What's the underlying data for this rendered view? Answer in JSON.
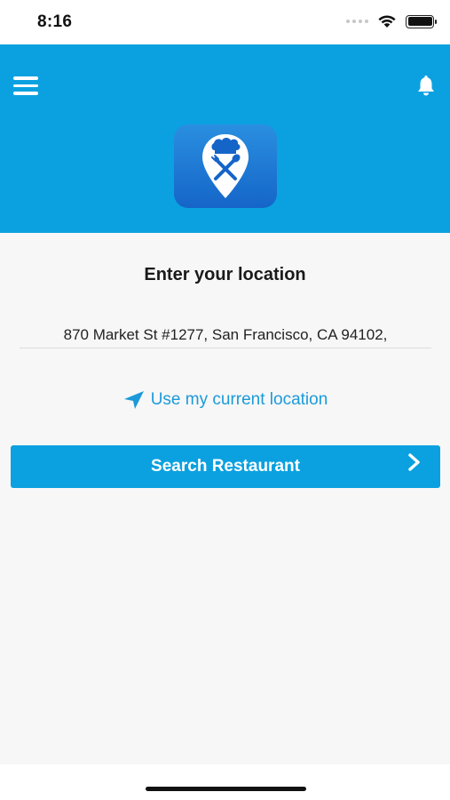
{
  "status_bar": {
    "time": "8:16"
  },
  "header": {
    "menu_icon": "hamburger-menu-icon",
    "bell_icon": "bell-icon",
    "logo_icon": "chef-location-pin-logo",
    "background_color": "#0ba1e0"
  },
  "main": {
    "title": "Enter your location",
    "address_value": "870 Market St #1277, San Francisco, CA 94102,",
    "current_location_label": "Use my current location",
    "current_location_icon": "location-arrow-icon",
    "search_button_label": "Search Restaurant",
    "search_button_icon": "chevron-right-icon",
    "accent_color": "#1b9ad9"
  }
}
